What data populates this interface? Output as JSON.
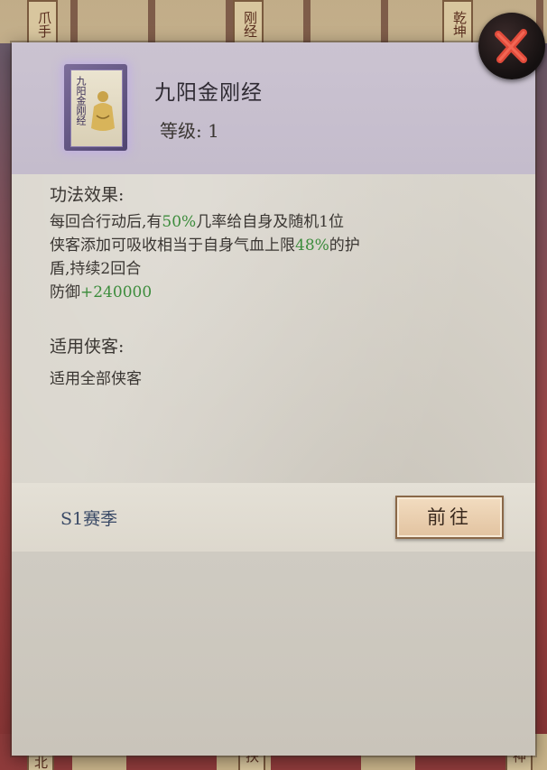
{
  "background": {
    "cards": [
      "爪手",
      "刚经",
      "乾坤",
      "神",
      "扶",
      "刺北"
    ]
  },
  "dialog": {
    "skill_name": "九阳金刚经",
    "book_cover_text": "九阳金刚经",
    "level_label": "等级:",
    "level_value": "1",
    "effect_title": "功法效果:",
    "effect_lines": [
      [
        "每回合行动后,有",
        "50%",
        "几率给自身及随机1位"
      ],
      [
        "侠客添加可吸收相当于自身气血上限",
        "48%",
        "的护"
      ],
      [
        "盾,持续2回合"
      ],
      [
        "防御",
        "+240000"
      ]
    ],
    "applicable_title": "适用侠客:",
    "applicable_value": "适用全部侠客",
    "season": "S1赛季",
    "goto_button": "前往"
  },
  "colors": {
    "highlight": "#3c8c3c",
    "close_x": "#e04a3a",
    "book_glow": "#bea8e6"
  },
  "icons": {
    "close": "close-x-icon",
    "book": "martial-art-book-icon"
  }
}
